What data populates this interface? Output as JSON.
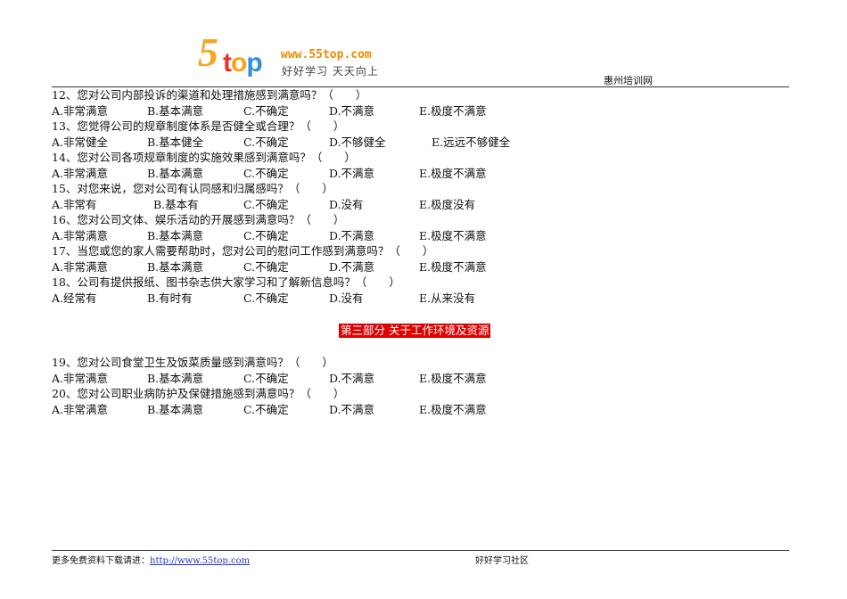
{
  "header": {
    "logo_url_text": "www.55top.com",
    "logo_slogan": "好好学习 天天向上",
    "logo_mark": "55top",
    "site_name": "惠州培训网"
  },
  "questions": [
    {
      "q": "12、您对公司内部投诉的渠道和处理措施感到满意吗？（　　）",
      "options": [
        "A.非常满意",
        "B.基本满意",
        "C.不确定",
        "D.不满意",
        "E.极度不满意"
      ]
    },
    {
      "q": "13、您觉得公司的规章制度体系是否健全或合理？（　　）",
      "options": [
        "A.非常健全",
        "B.基本健全",
        "C.不确定",
        "D.不够健全",
        "E.远远不够健全"
      ]
    },
    {
      "q": "14、您对公司各项规章制度的实施效果感到满意吗？（　　）",
      "options": [
        "A.非常满意",
        "B.基本满意",
        "C.不确定",
        "D.不满意",
        "E.极度不满意"
      ]
    },
    {
      "q": "15、对您来说，您对公司有认同感和归属感吗？（　　）",
      "options": [
        "A.非常有",
        "B.基本有",
        "C.不确定",
        "D.没有",
        "E.极度没有"
      ]
    },
    {
      "q": "16、您对公司文体、娱乐活动的开展感到满意吗？（　　）",
      "options": [
        "A.非常满意",
        "B.基本满意",
        "C.不确定",
        "D.不满意",
        "E.极度不满意"
      ]
    },
    {
      "q": "17、当您或您的家人需要帮助时，您对公司的慰问工作感到满意吗？（　　）",
      "options": [
        "A.非常满意",
        "B.基本满意",
        "C.不确定",
        "D.不满意",
        "E.极度不满意"
      ]
    },
    {
      "q": "18、公司有提供报纸、图书杂志供大家学习和了解新信息吗？（　　）",
      "options": [
        "A.经常有",
        "B.有时有",
        "C.不确定",
        "D.没有",
        "E.从来没有"
      ]
    }
  ],
  "section_title": "第三部分 关于工作环境及资源",
  "questions2": [
    {
      "q": "19、您对公司食堂卫生及饭菜质量感到满意吗？（　　）",
      "options": [
        "A.非常满意",
        "B.基本满意",
        "C.不确定",
        "D.不满意",
        "E.极度不满意"
      ]
    },
    {
      "q": "20、您对公司职业病防护及保健措施感到满意吗？（　　）",
      "options": [
        "A.非常满意",
        "B.基本满意",
        "C.不确定",
        "D.不满意",
        "E.极度不满意"
      ]
    }
  ],
  "footer": {
    "prefix": "更多免费资料下载请进：",
    "link": "http://www.55top.com",
    "right": "好好学习社区"
  }
}
